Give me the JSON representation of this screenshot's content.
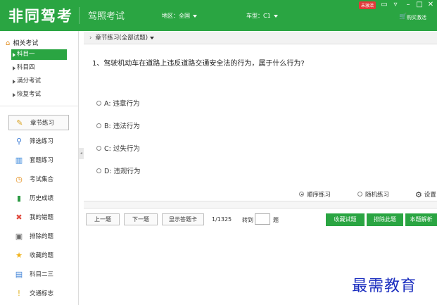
{
  "header": {
    "logo": "非同驾考",
    "subtitle": "驾照考试",
    "region": "地区：全国",
    "car_type": "车型：C1",
    "badge": "未激活",
    "buy": "购买激活",
    "controls": [
      "▭",
      "▿",
      "–",
      "□",
      "✕"
    ]
  },
  "sidebar": {
    "title": "相关考试",
    "sub_items": [
      {
        "label": "科目一",
        "active": true
      },
      {
        "label": "科目四",
        "active": false
      },
      {
        "label": "满分考试",
        "active": false
      },
      {
        "label": "恢复考试",
        "active": false
      }
    ],
    "nav": [
      {
        "label": "章节练习",
        "icon": "pencil-icon",
        "glyph": "✎",
        "color": "#d9a21e",
        "active": true
      },
      {
        "label": "筛选练习",
        "icon": "search-icon",
        "glyph": "⚲",
        "color": "#3a7bd5",
        "active": false
      },
      {
        "label": "套题练习",
        "icon": "books-icon",
        "glyph": "▥",
        "color": "#2b7fd9",
        "active": false
      },
      {
        "label": "考试集合",
        "icon": "clock-icon",
        "glyph": "◷",
        "color": "#e38a12",
        "active": false
      },
      {
        "label": "历史成绩",
        "icon": "bar-chart-icon",
        "glyph": "▮",
        "color": "#2f9b46",
        "active": false
      },
      {
        "label": "我的错题",
        "icon": "cross-icon",
        "glyph": "✖",
        "color": "#e0463a",
        "active": false
      },
      {
        "label": "排除的题",
        "icon": "trash-icon",
        "glyph": "▣",
        "color": "#6a6a6a",
        "active": false
      },
      {
        "label": "收藏的题",
        "icon": "star-icon",
        "glyph": "★",
        "color": "#f0b21a",
        "active": false
      },
      {
        "label": "科目二三",
        "icon": "book-icon",
        "glyph": "▤",
        "color": "#3b7fd6",
        "active": false
      },
      {
        "label": "交通标志",
        "icon": "warning-sign-icon",
        "glyph": "!",
        "color": "#e0b11c",
        "active": false
      }
    ]
  },
  "main": {
    "breadcrumb": "章节练习(全部试题)",
    "question": "1、驾驶机动车在道路上违反道路交通安全法的行为，属于什么行为?",
    "options": [
      "A: 违章行为",
      "B: 违法行为",
      "C: 过失行为",
      "D: 违规行为"
    ],
    "modes": {
      "sequential": "顺序练习",
      "random": "随机练习",
      "settings": "设置",
      "selected": "sequential"
    },
    "progress_fraction": 0,
    "buttons": {
      "prev": "上一题",
      "next": "下一题",
      "show_card": "显示答题卡",
      "counter": "1/1325",
      "goto": "转到",
      "ti": "题",
      "goto_value": "",
      "favorite": "收藏试题",
      "exclude": "排除此题",
      "explain": "本题解析"
    }
  },
  "watermark": "最需教育"
}
